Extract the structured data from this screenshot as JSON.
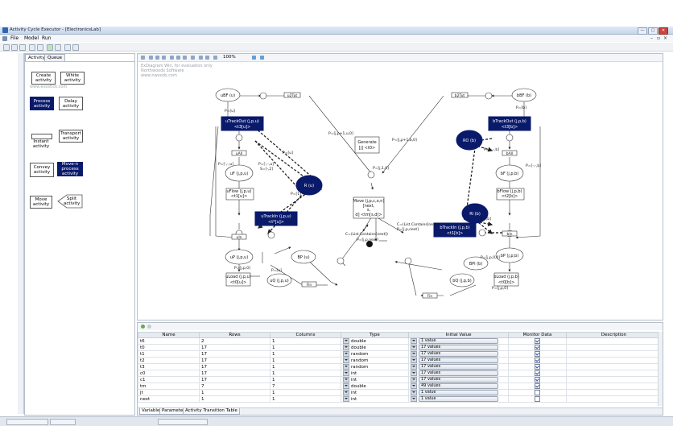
{
  "window": {
    "title": "Activity Cycle Executor - [ElectronicsLab]",
    "buttons": [
      "—",
      "▢",
      "✕"
    ]
  },
  "menu": {
    "items": [
      "File",
      "Model",
      "Run"
    ],
    "mdi_buttons": [
      "–",
      "▫",
      "×"
    ]
  },
  "left_panel": {
    "tabs": [
      "Activity",
      "Queue"
    ],
    "palette": [
      {
        "label": "Create activity",
        "style": "white"
      },
      {
        "label": "White activity",
        "style": "white"
      },
      {
        "label": "Process activity",
        "style": "navy"
      },
      {
        "label": "Delay activity",
        "style": "white"
      },
      {
        "label": "Instant activity",
        "style": "instant"
      },
      {
        "label": "Transport activity",
        "style": "white"
      },
      {
        "label": "Convey activity",
        "style": "white"
      },
      {
        "label": "Move-n process activity",
        "style": "navy"
      },
      {
        "label": "Move activity",
        "style": "white"
      },
      {
        "label": "Split activity",
        "style": "diamond"
      }
    ],
    "watermark": "www.evostick.com"
  },
  "canvas": {
    "zoom": "100%",
    "watermark_lines": [
      "ExDiagram Win, for evaluation only",
      "Northwoods Software",
      "www.nwoods.com"
    ],
    "nodes": {
      "uBF": "uBF (u)",
      "bBF": "bBF (b)",
      "uTrackOut": "uTrackOut (j,p,u)",
      "uTrackOut_sub": "<t3[u]>",
      "bTrackOut": "bTrackOut (j,p,b)",
      "bTrackOut_sub": "<t3[b]>",
      "uF": "uF (j,p,u)",
      "bF": "bF (j,p,b)",
      "R_u": "R (u)",
      "RO_b": "RO (b)",
      "RI_b": "RI (b)",
      "uFlow": "uFlow (j,p,u)",
      "uFlow_sub": "<t1[u]>",
      "bFlow": "bFlow (j,p,b)",
      "bFlow_sub": "<t2[b]>",
      "uTrackIn": "uTrackIn (j,p,u)",
      "uTrackIn_sub": "<t*[u]>",
      "bTrackIn": "bTrackIn (j,p,b)",
      "bTrackIn_sub": "<t1[b]>",
      "uP": "uP (j,p,u)",
      "bP": "bP (j,p,b)",
      "BP_u": "BP (u)",
      "BPI_b": "BPI (b)",
      "uLoad": "uLoad (j,p,u)",
      "uLoad_sub": "<t0[u]>",
      "bLoad": "bLoad (j,p,b)",
      "bLoad_sub": "<t0[b]>",
      "uQ": "uQ (j,p,u)",
      "bQ": "bQ (j,p,b)",
      "Generate": "Generate",
      "Generate_sub": "[j] <t0>",
      "Move1": "Move (j,p,c,o,n)",
      "Move2": "[next,",
      "Move3": "s,",
      "Move4": "d] <tm[s,d]>",
      "Fin": "Fin"
    },
    "edge_labels": {
      "uIsTrack": "u2Tut",
      "bIsTrack": "b2Tut",
      "pj_left": "P=[j,p+1,u,0]",
      "pj_right": "P=[j,p+1,b,0]",
      "p_u": "P=[u]",
      "p_b": "P=[b]",
      "r_u": "P=[u]",
      "r_b": "P=[b]",
      "p_minus": "P=[-,-,u]",
      "s_minus": "S=[-,2]",
      "p1": "P=[1]",
      "pj1": "P=[j,1,0]",
      "c_ls": "C=(List.Contains[next])",
      "p_next": "P=[j,p,next]",
      "c_ls2": "C=(List.Contains[next])",
      "p_next2": "P=[j,p,next]",
      "p_jp": "P=[j,p,0]",
      "p_minus2": "P=[-,-,b]",
      "pu": "P=[-,-,u]",
      "pb": "P=[-,-,b]",
      "pu2": "P=[u]",
      "pb2": "P=[b]",
      "uin": "uIn",
      "bin": "bIn",
      "uout": "uOut",
      "bout": "bOut",
      "uall": "uAll",
      "ball": "bAll",
      "ufin": "Fin",
      "bfin": "Fin",
      "p_mid": "P=[j,p,0,0]",
      "p_end": "P=[j,p,0]"
    }
  },
  "grid": {
    "columns": [
      "Name",
      "Rows",
      "Columns",
      "Type",
      "Initial Value",
      "Monitor Data",
      "Description"
    ],
    "rows": [
      {
        "name": "t6",
        "rows": "2",
        "cols": "1",
        "type": "double",
        "init": "1 value",
        "monitor": true
      },
      {
        "name": "t0",
        "rows": "17",
        "cols": "1",
        "type": "double",
        "init": "17 values",
        "monitor": true
      },
      {
        "name": "t1",
        "rows": "17",
        "cols": "1",
        "type": "random",
        "init": "17 values",
        "monitor": true
      },
      {
        "name": "t2",
        "rows": "17",
        "cols": "1",
        "type": "random",
        "init": "17 values",
        "monitor": true
      },
      {
        "name": "t3",
        "rows": "17",
        "cols": "1",
        "type": "random",
        "init": "17 values",
        "monitor": true
      },
      {
        "name": "c0",
        "rows": "17",
        "cols": "1",
        "type": "int",
        "init": "17 values",
        "monitor": true
      },
      {
        "name": "c1",
        "rows": "17",
        "cols": "1",
        "type": "int",
        "init": "17 values",
        "monitor": true
      },
      {
        "name": "tm",
        "rows": "7",
        "cols": "7",
        "type": "double",
        "init": "49 values",
        "monitor": true
      },
      {
        "name": "jt",
        "rows": "1",
        "cols": "1",
        "type": "int",
        "init": "1 value",
        "monitor": false
      },
      {
        "name": "next",
        "rows": "1",
        "cols": "1",
        "type": "int",
        "init": "1 value",
        "monitor": false
      }
    ],
    "tabs": [
      "Variable",
      "Parameter",
      "Activity Transition Table"
    ]
  }
}
